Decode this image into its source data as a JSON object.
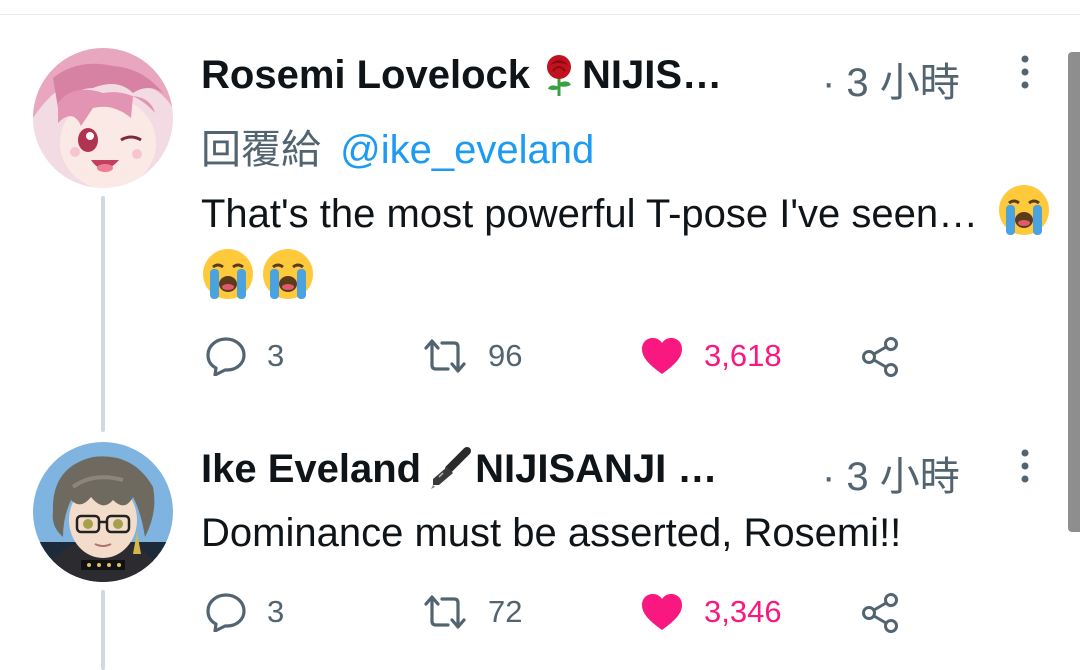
{
  "tweets": [
    {
      "name": "Rosemi Lovelock",
      "name_suffix": "NIJIS…",
      "name_emoji": "rose",
      "time": "· 3 小時",
      "reply_prefix": "回覆給",
      "reply_handle": "@ike_eveland",
      "text": "That's the most powerful T-pose I've seen…",
      "emojis": [
        "loudly-crying-face",
        "loudly-crying-face",
        "loudly-crying-face"
      ],
      "replies": "3",
      "retweets": "96",
      "likes": "3,618",
      "liked": true
    },
    {
      "name": "Ike Eveland",
      "name_suffix": "NIJISANJI …",
      "name_emoji": "fountain-pen",
      "time": "· 3 小時",
      "text": "Dominance must be asserted, Rosemi!!",
      "replies": "3",
      "retweets": "72",
      "likes": "3,346",
      "liked": true
    }
  ],
  "colors": {
    "text": "#0f1419",
    "muted": "#536471",
    "mention": "#1d9bf0",
    "like": "#f91880",
    "thread_line": "#cfd9de"
  }
}
